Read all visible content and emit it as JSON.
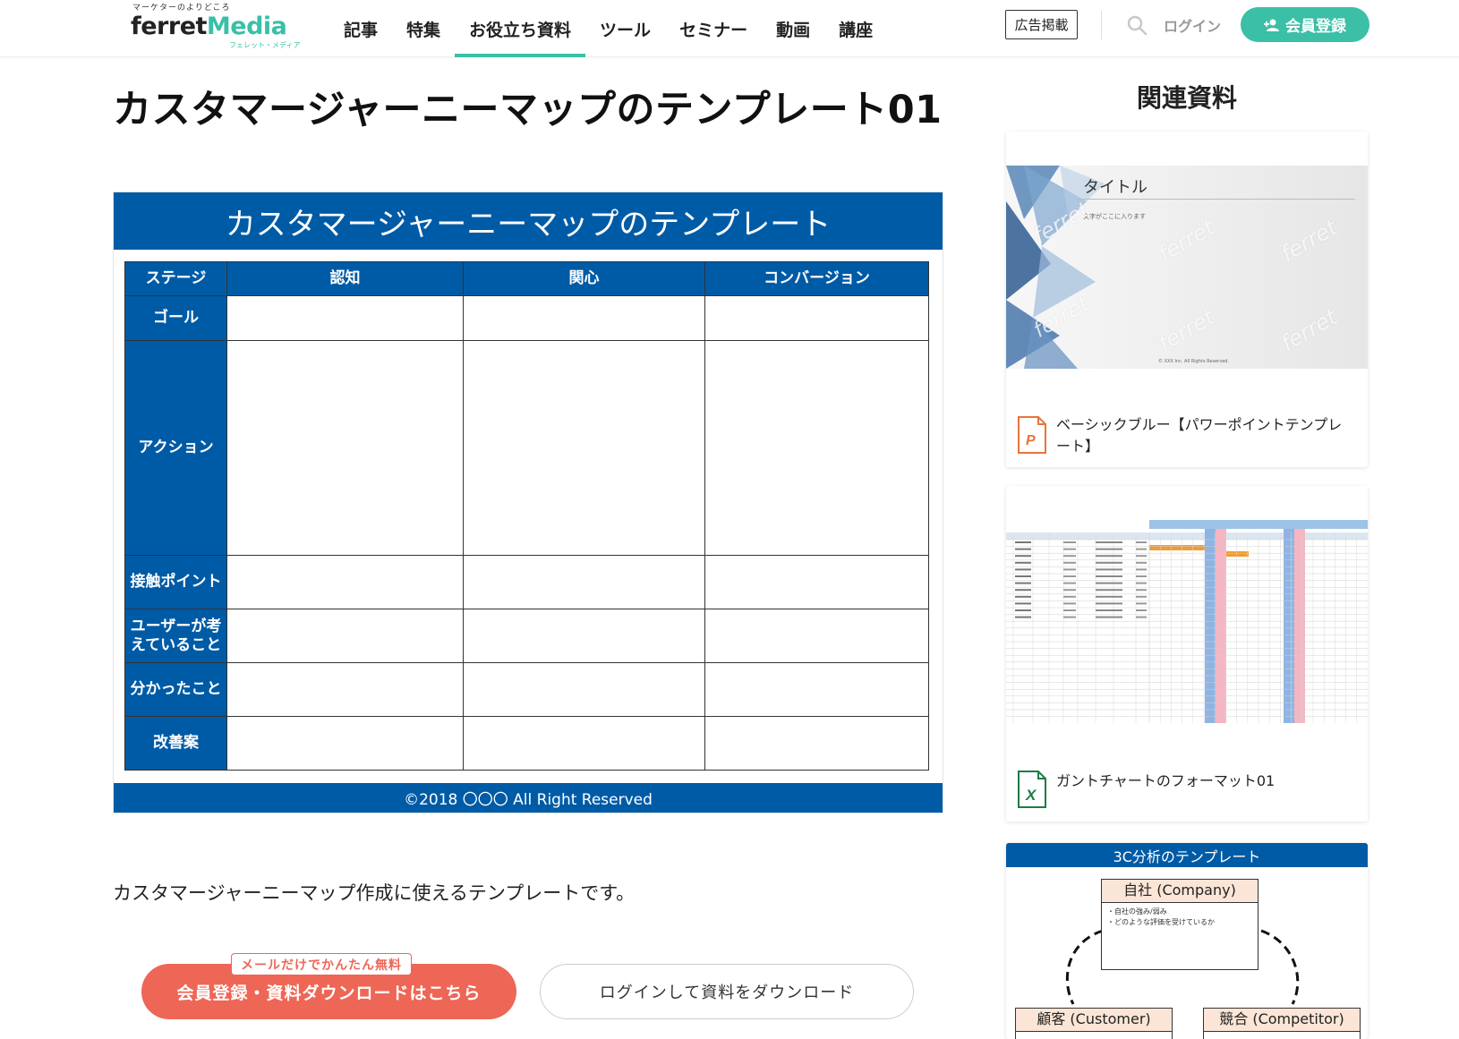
{
  "header": {
    "logo": {
      "tagline": "マーケターのよりどころ",
      "brand_part1": "ferret",
      "brand_part2": "Media",
      "sub": "フェレット・メディア"
    },
    "nav": [
      {
        "label": "記事"
      },
      {
        "label": "特集"
      },
      {
        "label": "お役立ち資料",
        "active": true
      },
      {
        "label": "ツール"
      },
      {
        "label": "セミナー"
      },
      {
        "label": "動画"
      },
      {
        "label": "講座"
      }
    ],
    "ad_label": "広告掲載",
    "login_label": "ログイン",
    "register_label": "会員登録",
    "accent_color": "#3bbfa7"
  },
  "main": {
    "title": "カスタマージャーニーマップのテンプレート01",
    "template": {
      "header": "カスタマージャーニーマップのテンプレート",
      "columns": [
        "ステージ",
        "認知",
        "関心",
        "コンバージョン"
      ],
      "rows": [
        "ゴール",
        "アクション",
        "接触ポイント",
        "ユーザーが考えていること",
        "分かったこと",
        "改善案"
      ],
      "footer": "©2018 〇〇〇 All Right Reserved",
      "brand_color": "#005ba6"
    },
    "description": "カスタマージャーニーマップ作成に使えるテンプレートです。",
    "download_primary": "会員登録・資料ダウンロードはこちら",
    "free_badge": "メールだけでかんたん無料",
    "download_secondary": "ログインして資料をダウンロード",
    "cta_color": "#ee6656"
  },
  "sidebar": {
    "heading": "関連資料",
    "cards": [
      {
        "label": "ベーシックブルー【パワーポイントテンプレート】",
        "file_type": "powerpoint-icon",
        "thumb": {
          "title": "タイトル",
          "subtitle": "文字がここに入ります",
          "copyright": "© XXX Inc. All Rights Reserved.",
          "watermark": "ferret"
        }
      },
      {
        "label": "ガントチャートのフォーマット01",
        "file_type": "excel-icon"
      },
      {
        "thumb": {
          "header": "3C分析のテンプレート",
          "company": "自社 (Company)",
          "company_notes": [
            "・自社の強み/弱み",
            "・どのような評価を受けているか"
          ],
          "customer": "顧客 (Customer)",
          "competitor": "競合 (Competitor)"
        }
      }
    ]
  }
}
